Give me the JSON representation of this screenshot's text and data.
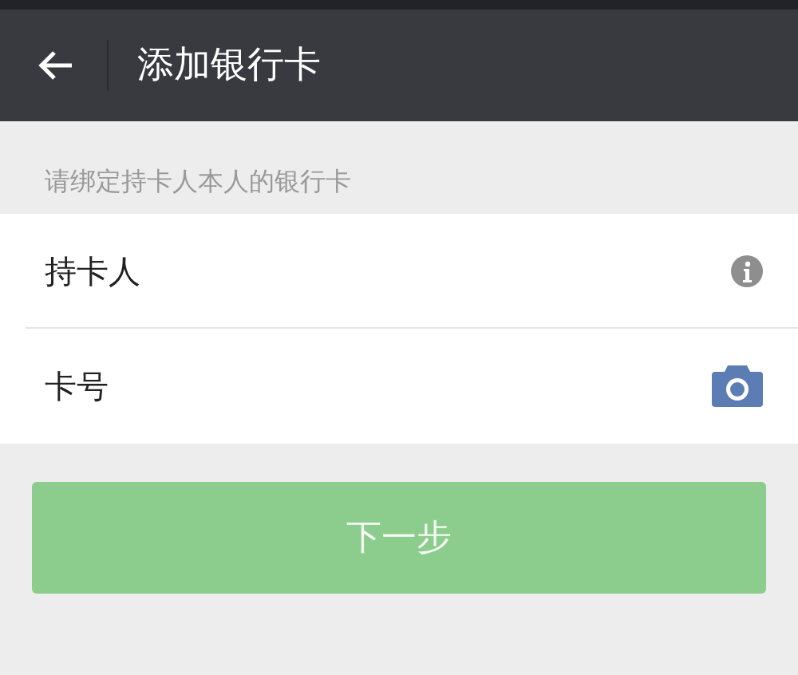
{
  "header": {
    "title": "添加银行卡"
  },
  "hint": "请绑定持卡人本人的银行卡",
  "fields": [
    {
      "label": "持卡人",
      "kind": "info"
    },
    {
      "label": "卡号",
      "kind": "camera"
    }
  ],
  "next_button": {
    "label": "下一步",
    "disabled": true
  }
}
